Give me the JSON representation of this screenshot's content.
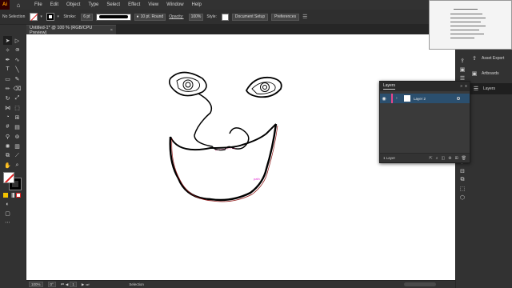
{
  "app": {
    "logo": "Ai",
    "menu": [
      "File",
      "Edit",
      "Object",
      "Type",
      "Select",
      "Effect",
      "View",
      "Window",
      "Help"
    ]
  },
  "control_bar": {
    "selection_label": "No Selection",
    "stroke_label": "Stroke:",
    "stroke_value": "6 pt",
    "brush_label": "10 pt. Round",
    "opacity_label": "Opacity:",
    "opacity_value": "100%",
    "style_label": "Style:",
    "doc_setup": "Document Setup",
    "preferences": "Preferences"
  },
  "document": {
    "tab_title": "Untitled-1* @ 100 % (RGB/CPU Preview)",
    "close_glyph": "×"
  },
  "right_dock": {
    "asset_export": "Asset Export",
    "artboards": "Artboards",
    "layers": "Layers"
  },
  "layers_panel": {
    "title": "Layers",
    "layer_name": "Layer 2",
    "footer": "1 Layer",
    "layer_color": "#e8458b"
  },
  "status_bar": {
    "zoom": "100%",
    "rotation": "0°",
    "artboard": "1",
    "status": "Selection"
  },
  "colors": {
    "accent_row": "#2b4f6e",
    "ui_bg": "#323232",
    "artboard": "#ffffff"
  }
}
